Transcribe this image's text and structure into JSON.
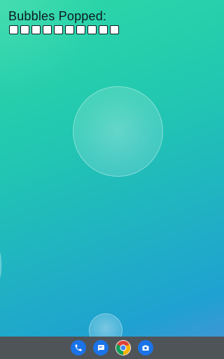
{
  "header": {
    "title": "Bubbles Popped:",
    "counter_slots": 10
  },
  "colors": {
    "background_top": "#2ed9a6",
    "background_bottom": "#1fa1d1",
    "dock": "#4f5458",
    "app_blue": "#1a73e8"
  },
  "dock": {
    "apps": [
      {
        "name": "phone",
        "icon": "phone-icon"
      },
      {
        "name": "messages",
        "icon": "messages-icon"
      },
      {
        "name": "chrome",
        "icon": "chrome-icon"
      },
      {
        "name": "camera",
        "icon": "camera-icon"
      }
    ]
  }
}
